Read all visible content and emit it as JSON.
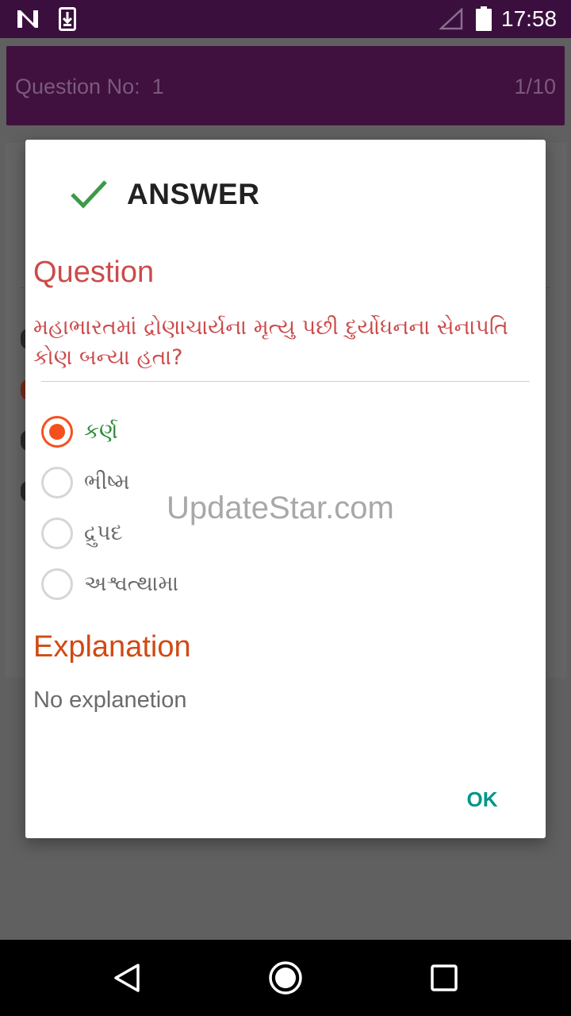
{
  "status_bar": {
    "time": "17:58",
    "icons": [
      "n-notification-icon",
      "download-icon",
      "signal-icon",
      "battery-icon"
    ]
  },
  "header": {
    "question_label": "Question No:",
    "question_number": "1",
    "progress": "1/10"
  },
  "dialog": {
    "title": "ANSWER",
    "title_icon": "check-icon",
    "question_heading": "Question",
    "question_text": "મહાભારતમાં દ્રોણાચાર્યના મૃત્યુ પછી દુર્યોધનના સેનાપતિ કોણ બન્યા હતા?",
    "options": [
      {
        "label": "કર્ણ",
        "selected": true
      },
      {
        "label": "ભીષ્મ",
        "selected": false
      },
      {
        "label": "દ્રુપદ",
        "selected": false
      },
      {
        "label": "અશ્વત્થામા",
        "selected": false
      }
    ],
    "explanation_heading": "Explanation",
    "explanation_text": "No explanetion",
    "ok_label": "OK"
  },
  "watermark": "UpdateStar.com",
  "colors": {
    "status_bar": "#3a0f3e",
    "header": "#40103f",
    "question_red": "#cc4b4b",
    "correct_green": "#2e8b3a",
    "radio_accent": "#f4511e",
    "explanation_orange": "#d04a14",
    "ok_teal": "#00968a"
  }
}
